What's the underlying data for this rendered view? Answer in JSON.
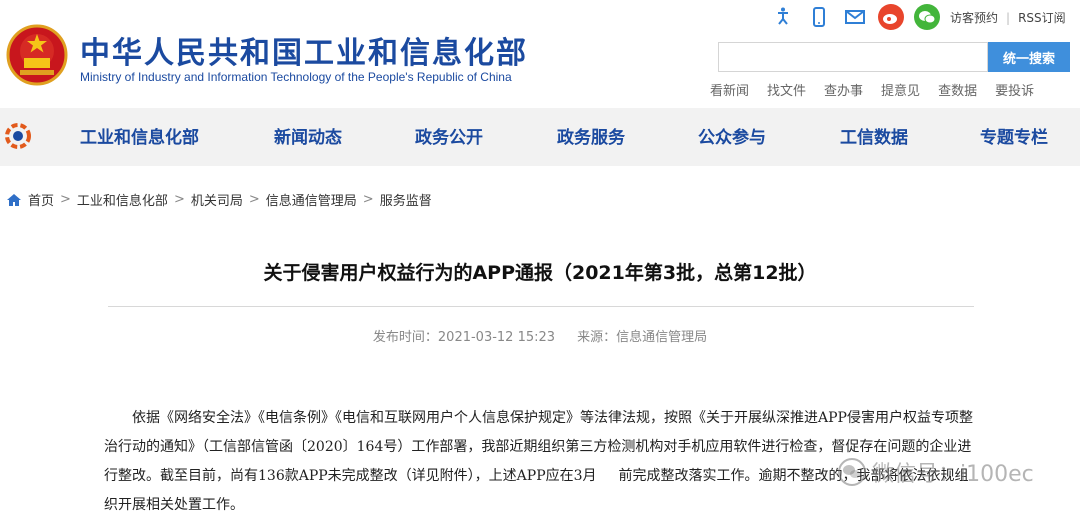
{
  "header": {
    "title": "中华人民共和国工业和信息化部",
    "subtitle": "Ministry of Industry and Information Technology of the People's Republic of China",
    "top_links": [
      "访客预约",
      "RSS订阅"
    ],
    "search_button": "统一搜索",
    "search_placeholder": "",
    "quick_links": [
      "看新闻",
      "找文件",
      "查办事",
      "提意见",
      "查数据",
      "要投诉"
    ]
  },
  "nav": {
    "items": [
      "工业和信息化部",
      "新闻动态",
      "政务公开",
      "政务服务",
      "公众参与",
      "工信数据",
      "专题专栏"
    ]
  },
  "breadcrumb": [
    "首页",
    "工业和信息化部",
    "机关司局",
    "信息通信管理局",
    "服务监督"
  ],
  "article": {
    "title": "关于侵害用户权益行为的APP通报（2021年第3批，总第12批）",
    "publish_label": "发布时间：2021-03-12 15:23",
    "source_label": "来源：信息通信管理局",
    "body": "依据《网络安全法》《电信条例》《电信和互联网用户个人信息保护规定》等法律法规，按照《关于开展纵深推进APP侵害用户权益专项整治行动的通知》（工信部信管函〔2020〕164号）工作部署，我部近期组织第三方检测机构对手机应用软件进行检查，督促存在问题的企业进行整改。截至目前，尚有136款APP未完成整改（详见附件），上述APP应在3月",
    "body_tail": "前完成整改落实工作。逾期不整改的，我部将依法依规组织开展相关处置工作。"
  },
  "watermark": "微信号：i100ec",
  "colors": {
    "brand": "#1b4aa0",
    "search_button": "#3f8fdc",
    "nav_bg": "#f2f2f2"
  }
}
